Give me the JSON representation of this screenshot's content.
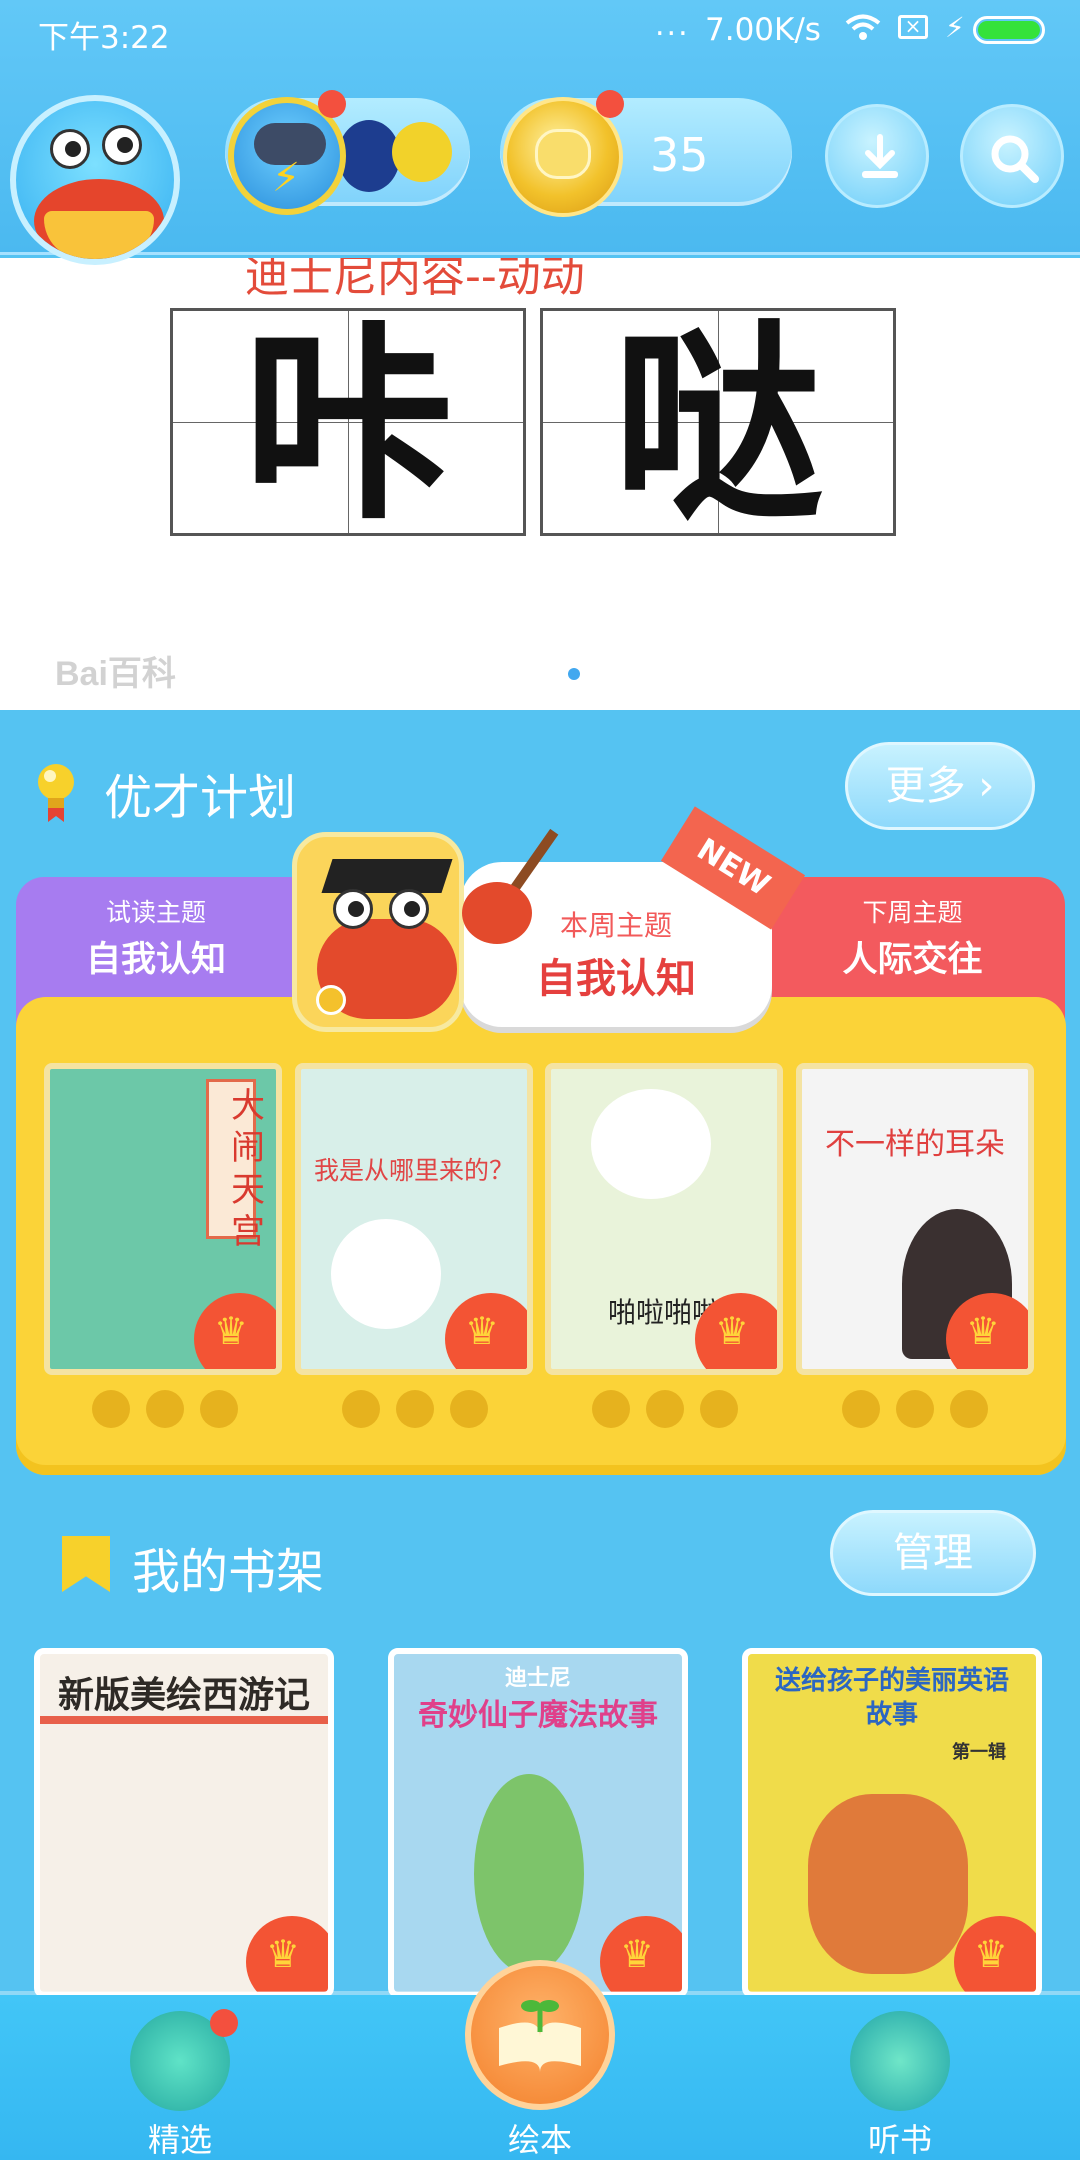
{
  "status_bar": {
    "time": "下午3:22",
    "dots": "...",
    "network_speed": "7.00K/s",
    "battery_level": 1.0
  },
  "header": {
    "coins": "35"
  },
  "banner": {
    "caption": "迪士尼内容--动动",
    "characters": [
      "咔",
      "哒"
    ],
    "watermark": "Bai百科",
    "active_slide": 1
  },
  "plan": {
    "title": "优才计划",
    "more_label": "更多",
    "tabs": {
      "trial": {
        "small": "试读主题",
        "big": "自我认知"
      },
      "current": {
        "small": "本周主题",
        "big": "自我认知",
        "badge": "NEW"
      },
      "next": {
        "small": "下周主题",
        "big": "人际交往"
      }
    },
    "books": [
      {
        "title": "大闹天宫",
        "color": "#6cc8a8"
      },
      {
        "title": "我是从哪里来的？",
        "color": "#d8efe9"
      },
      {
        "title": "啪啦啪啦",
        "color": "#e9f3da"
      },
      {
        "title": "不一样的耳朵",
        "color": "#f4f4f4"
      }
    ]
  },
  "shelf": {
    "title": "我的书架",
    "manage_label": "管理",
    "books": [
      {
        "title": "新版美绘西游记",
        "color": "#f6f0e8"
      },
      {
        "title": "奇妙仙子魔法故事",
        "color": "#a8d8f0",
        "subtitle": "迪士尼"
      },
      {
        "title": "送给孩子的美丽英语故事",
        "color": "#f0dc4a",
        "subtitle": "第一辑"
      }
    ]
  },
  "bottom_nav": {
    "items": [
      {
        "label": "精选"
      },
      {
        "label": "绘本"
      },
      {
        "label": "听书"
      }
    ]
  },
  "colors": {
    "background": "#55c3f2",
    "plan_panel": "#fbd338",
    "trial_tab": "#a77cf0",
    "next_tab": "#f35a5e",
    "accent_red": "#e5403e"
  }
}
